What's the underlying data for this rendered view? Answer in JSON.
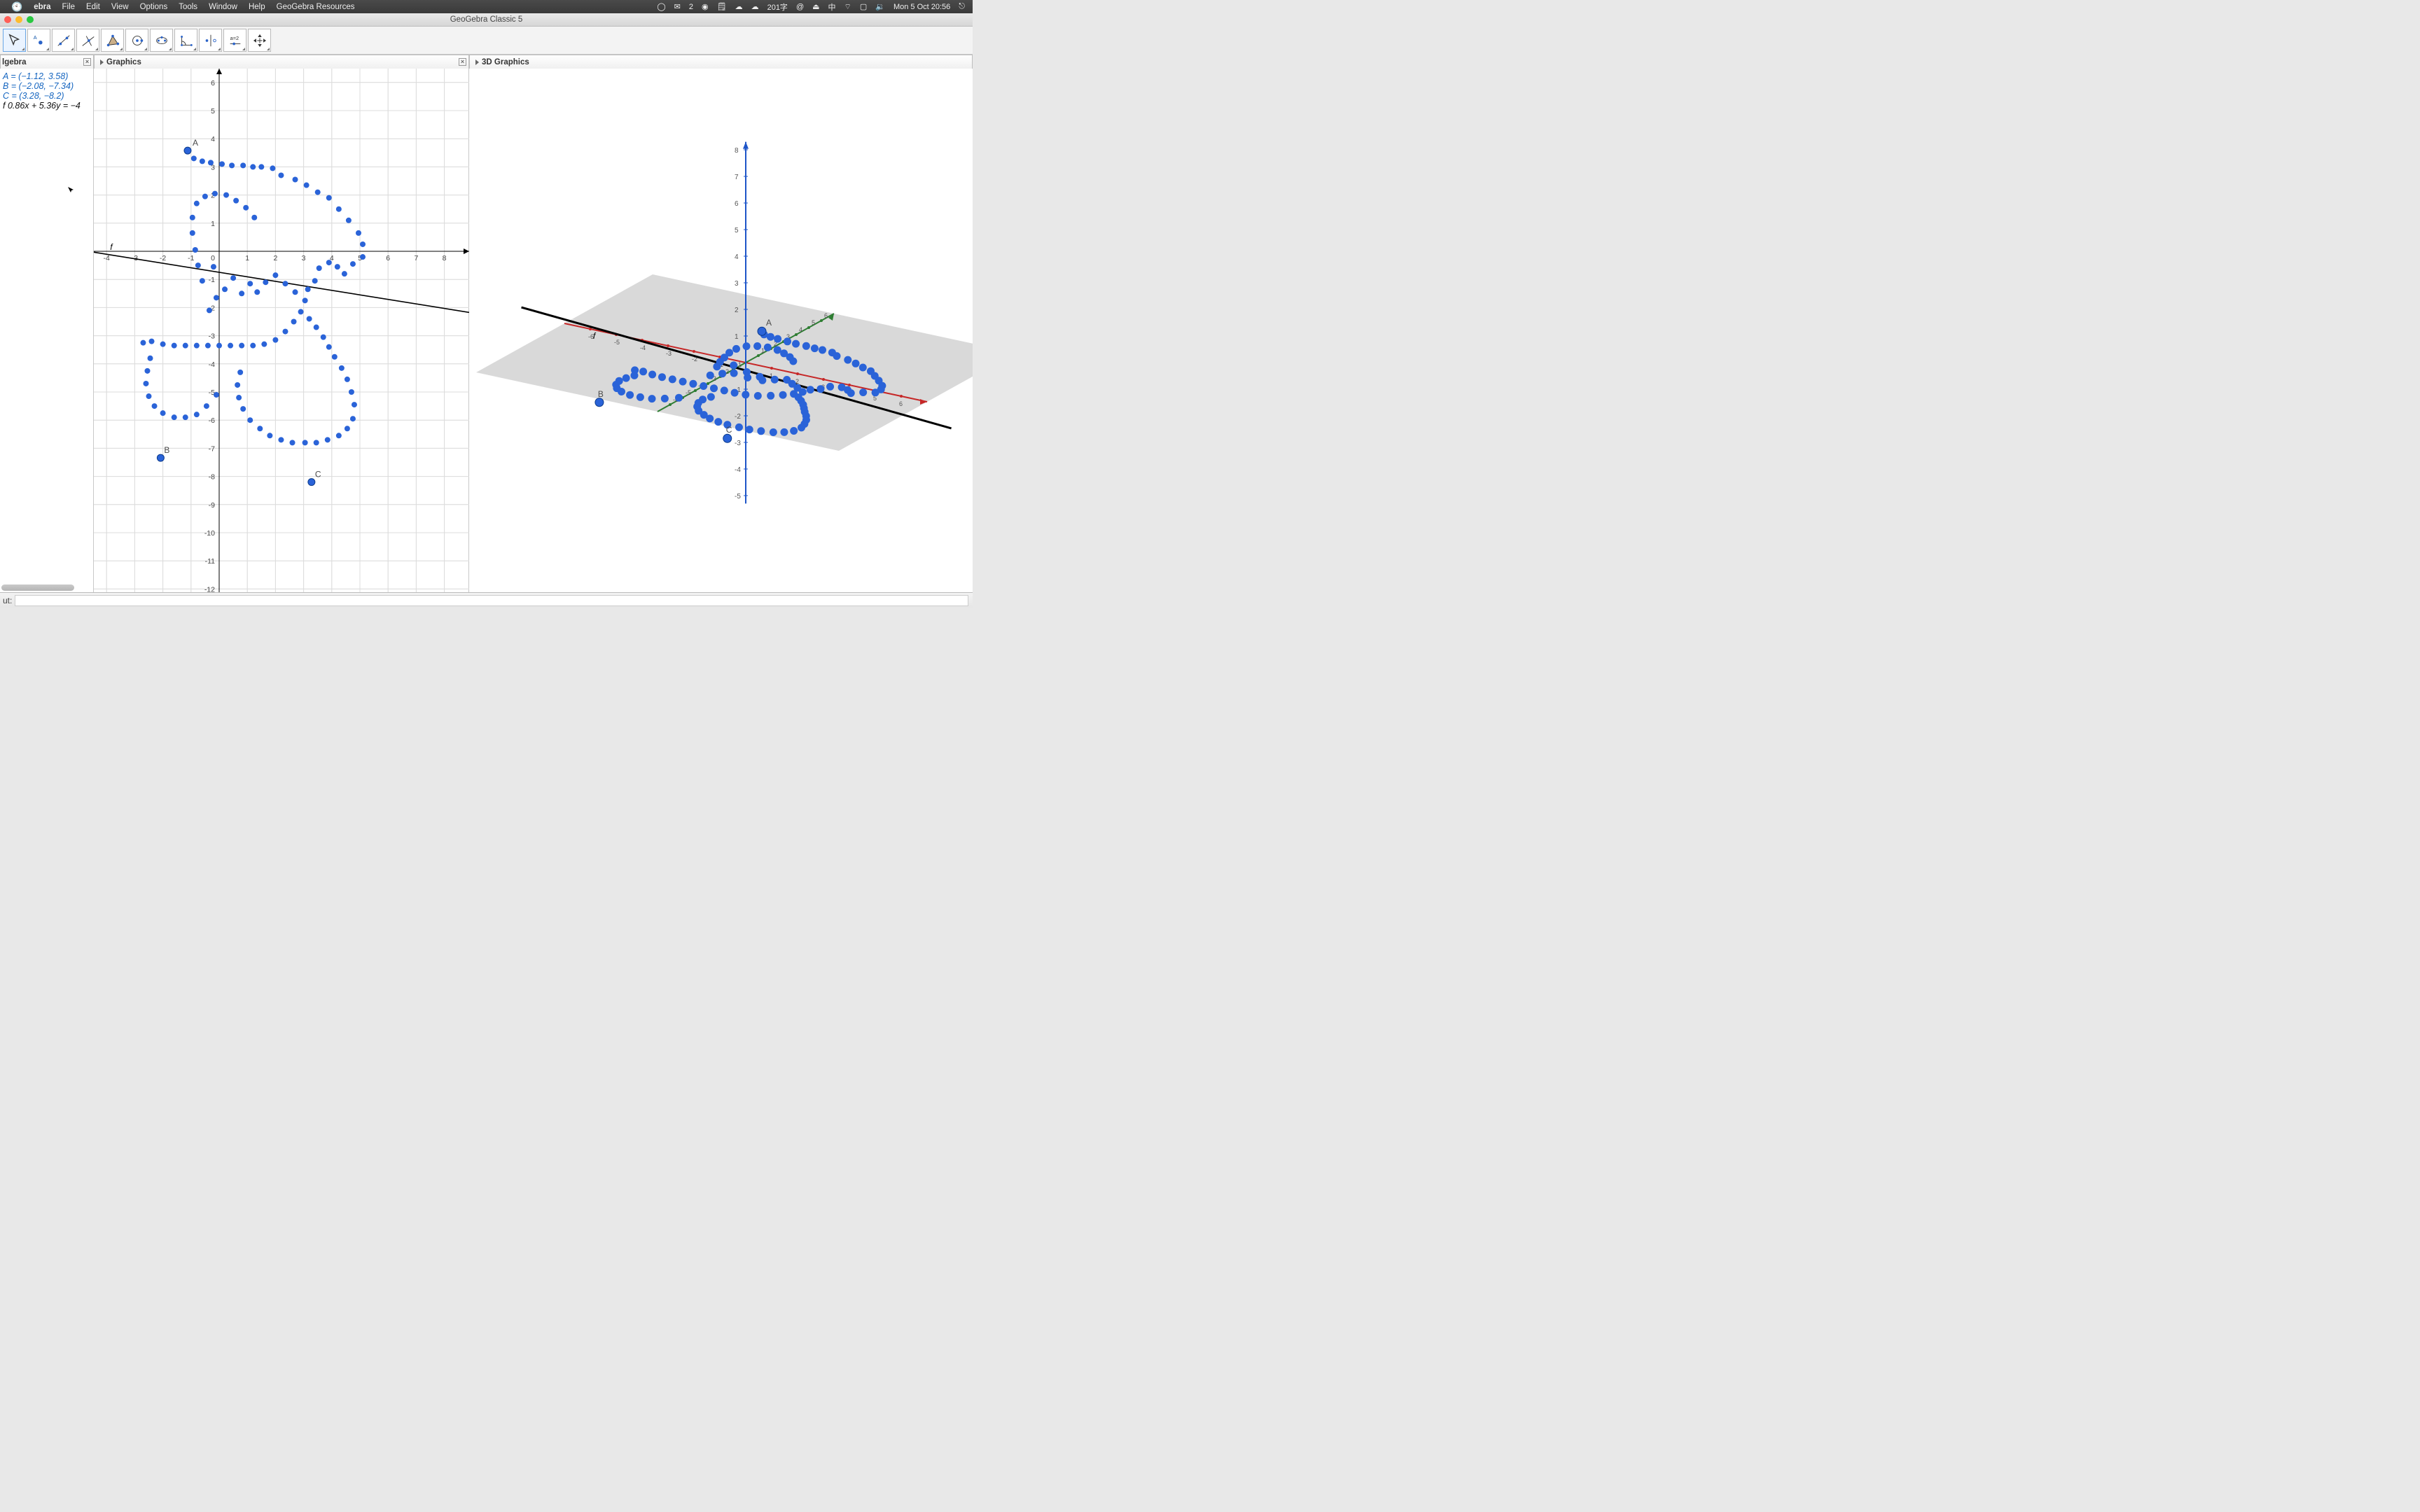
{
  "menubar": {
    "app": "ebra",
    "items": [
      "File",
      "Edit",
      "View",
      "Options",
      "Tools",
      "Window",
      "Help",
      "GeoGebra Resources"
    ],
    "right": {
      "badge": "2",
      "network": "201字",
      "ime": "中",
      "clock": "Mon 5 Oct  20:56"
    }
  },
  "window": {
    "title": "GeoGebra Classic 5"
  },
  "tabs": {
    "algebra": "lgebra",
    "graphics": "Graphics",
    "graphics3d": "3D Graphics"
  },
  "algebra": {
    "A": {
      "label": "A",
      "value": "= (−1.12, 3.58)"
    },
    "B": {
      "label": "B",
      "value": "= (−2.08, −7.34)"
    },
    "C": {
      "label": "C",
      "value": "= (3.28, −8.2)"
    },
    "f": {
      "label": "f",
      "value": "0.86x + 5.36y = −4"
    }
  },
  "inputbar": {
    "label": "ut:"
  },
  "chart_data": {
    "type": "scatter",
    "title": "",
    "xlabel": "",
    "ylabel": "",
    "graphics2d": {
      "xlim": [
        -4,
        8
      ],
      "ylim": [
        -12,
        6
      ],
      "xticks": [
        -4,
        -3,
        -2,
        -1,
        0,
        1,
        2,
        3,
        4,
        5,
        6,
        7,
        8
      ],
      "yticks": [
        -12,
        -11,
        -10,
        -9,
        -8,
        -7,
        -6,
        -5,
        -4,
        -3,
        -2,
        -1,
        1,
        2,
        3,
        4,
        5,
        6
      ],
      "named_points": {
        "A": [
          -1.12,
          3.58
        ],
        "B": [
          -2.08,
          -7.34
        ],
        "C": [
          3.28,
          -8.2
        ]
      },
      "line_f_label": "f",
      "line_f": {
        "equation": "0.86x + 5.36y = -4",
        "p1": [
          -4,
          -0.104
        ],
        "p2": [
          8,
          -2.03
        ]
      },
      "scatter": [
        [
          -1.12,
          3.58
        ],
        [
          -0.9,
          3.3
        ],
        [
          -0.6,
          3.2
        ],
        [
          -0.3,
          3.15
        ],
        [
          0.1,
          3.1
        ],
        [
          0.45,
          3.05
        ],
        [
          0.85,
          3.05
        ],
        [
          1.2,
          3.0
        ],
        [
          1.5,
          3.0
        ],
        [
          1.9,
          2.95
        ],
        [
          2.2,
          2.7
        ],
        [
          2.7,
          2.55
        ],
        [
          3.1,
          2.35
        ],
        [
          3.5,
          2.1
        ],
        [
          3.9,
          1.9
        ],
        [
          4.25,
          1.5
        ],
        [
          4.6,
          1.1
        ],
        [
          4.95,
          0.65
        ],
        [
          5.1,
          0.25
        ],
        [
          5.1,
          -0.2
        ],
        [
          4.75,
          -0.45
        ],
        [
          4.45,
          -0.8
        ],
        [
          4.2,
          -0.55
        ],
        [
          3.9,
          -0.4
        ],
        [
          3.55,
          -0.6
        ],
        [
          3.4,
          -1.05
        ],
        [
          3.15,
          -1.35
        ],
        [
          3.05,
          -1.75
        ],
        [
          2.7,
          -1.45
        ],
        [
          2.35,
          -1.15
        ],
        [
          2.0,
          -0.85
        ],
        [
          1.65,
          -1.1
        ],
        [
          1.35,
          -1.45
        ],
        [
          1.1,
          -1.15
        ],
        [
          0.8,
          -1.5
        ],
        [
          0.5,
          -0.95
        ],
        [
          0.2,
          -1.35
        ],
        [
          -0.2,
          -0.55
        ],
        [
          -0.1,
          -1.65
        ],
        [
          -0.35,
          -2.1
        ],
        [
          -0.6,
          -1.05
        ],
        [
          -0.75,
          -0.5
        ],
        [
          -0.85,
          0.05
        ],
        [
          -0.95,
          0.65
        ],
        [
          -0.95,
          1.2
        ],
        [
          -0.8,
          1.7
        ],
        [
          -0.5,
          1.95
        ],
        [
          -0.15,
          2.05
        ],
        [
          0.25,
          2.0
        ],
        [
          0.6,
          1.8
        ],
        [
          0.95,
          1.55
        ],
        [
          1.25,
          1.2
        ],
        [
          -2.4,
          -3.2
        ],
        [
          -2.0,
          -3.3
        ],
        [
          -1.6,
          -3.35
        ],
        [
          -1.2,
          -3.35
        ],
        [
          -0.8,
          -3.35
        ],
        [
          -0.4,
          -3.35
        ],
        [
          0.0,
          -3.35
        ],
        [
          0.4,
          -3.35
        ],
        [
          0.8,
          -3.35
        ],
        [
          1.2,
          -3.35
        ],
        [
          1.6,
          -3.3
        ],
        [
          2.0,
          -3.15
        ],
        [
          2.35,
          -2.85
        ],
        [
          2.65,
          -2.5
        ],
        [
          2.9,
          -2.15
        ],
        [
          3.2,
          -2.4
        ],
        [
          3.45,
          -2.7
        ],
        [
          3.7,
          -3.05
        ],
        [
          3.9,
          -3.4
        ],
        [
          4.1,
          -3.75
        ],
        [
          4.35,
          -4.15
        ],
        [
          4.55,
          -4.55
        ],
        [
          4.7,
          -5.0
        ],
        [
          4.8,
          -5.45
        ],
        [
          4.75,
          -5.95
        ],
        [
          4.55,
          -6.3
        ],
        [
          4.25,
          -6.55
        ],
        [
          3.85,
          -6.7
        ],
        [
          3.45,
          -6.8
        ],
        [
          3.05,
          -6.8
        ],
        [
          2.6,
          -6.8
        ],
        [
          2.2,
          -6.7
        ],
        [
          1.8,
          -6.55
        ],
        [
          1.45,
          -6.3
        ],
        [
          1.1,
          -6.0
        ],
        [
          0.85,
          -5.6
        ],
        [
          0.7,
          -5.2
        ],
        [
          0.65,
          -4.75
        ],
        [
          0.75,
          -4.3
        ],
        [
          -2.7,
          -3.25
        ],
        [
          -0.1,
          -5.1
        ],
        [
          -0.45,
          -5.5
        ],
        [
          -0.8,
          -5.8
        ],
        [
          -1.2,
          -5.9
        ],
        [
          -1.6,
          -5.9
        ],
        [
          -2.0,
          -5.75
        ],
        [
          -2.3,
          -5.5
        ],
        [
          -2.5,
          -5.15
        ],
        [
          -2.6,
          -4.7
        ],
        [
          -2.55,
          -4.25
        ],
        [
          -2.45,
          -3.8
        ]
      ]
    },
    "graphics3d": {
      "z_ticks": [
        -5,
        -4,
        -3,
        -2,
        -1,
        1,
        2,
        3,
        4,
        5,
        6,
        7,
        8
      ],
      "x_ticks": [
        -6,
        -5,
        -4,
        -3,
        -2,
        -1,
        1,
        2,
        3,
        4,
        5,
        6
      ],
      "y_ticks": [
        -6,
        -5,
        -4,
        -3,
        -2,
        -1,
        1,
        2,
        3,
        4,
        5,
        6
      ],
      "labels": {
        "A": "A",
        "B": "B",
        "C": "C",
        "f": "f"
      }
    }
  }
}
